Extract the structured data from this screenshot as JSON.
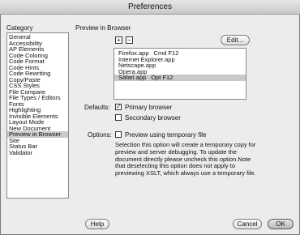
{
  "window": {
    "title": "Preferences"
  },
  "category": {
    "header": "Category",
    "items": [
      "General",
      "Accessibility",
      "AP Elements",
      "Code Coloring",
      "Code Format",
      "Code Hints",
      "Code Rewriting",
      "Copy/Paste",
      "CSS Styles",
      "File Compare",
      "File Types / Editors",
      "Fonts",
      "Highlighting",
      "Invisible Elements",
      "Layout Mode",
      "New Document",
      "Preview in Browser",
      "Site",
      "Status Bar",
      "Validator"
    ],
    "selected_index": 16
  },
  "panel": {
    "title": "Preview in Browser",
    "add_label": "+",
    "remove_label": "−",
    "edit_label": "Edit...",
    "browsers": [
      {
        "name": "Firefox.app",
        "shortcut": "Cmd F12"
      },
      {
        "name": "Internet Explorer.app",
        "shortcut": ""
      },
      {
        "name": "Netscape.app",
        "shortcut": ""
      },
      {
        "name": "Opera.app",
        "shortcut": ""
      },
      {
        "name": "Safari.app",
        "shortcut": "Opt F12"
      }
    ],
    "selected_browser": 4,
    "defaults_label": "Defaults:",
    "primary_label": "Primary browser",
    "primary_checked": true,
    "secondary_label": "Secondary browser",
    "secondary_checked": false,
    "options_label": "Options:",
    "temp_label": "Preview using temporary file",
    "temp_checked": false,
    "description": "Selection this option will create a temporary copy for preview and server debugging. To update the document directly please uncheck this option.Note that deselecting this option does not apply to previewing XSLT, which always use a temporary file."
  },
  "footer": {
    "help_label": "Help",
    "cancel_label": "Cancel",
    "ok_label": "OK"
  }
}
